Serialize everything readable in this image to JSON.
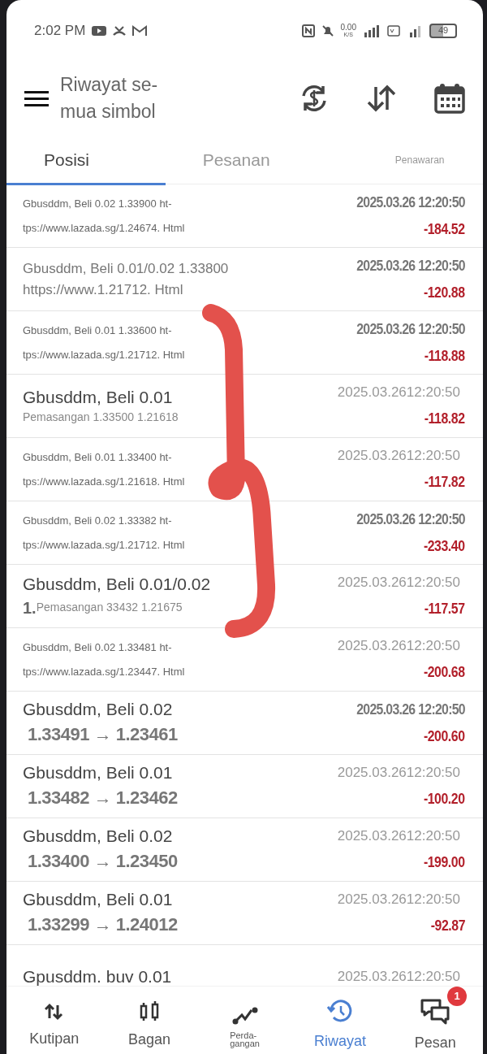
{
  "status_bar": {
    "time": "2:02 PM",
    "net_speed": "0.00",
    "net_unit": "K/S",
    "battery": "49"
  },
  "app_bar": {
    "title": "Riwayat se-\nmua simbol"
  },
  "tabs": [
    {
      "label": "Posisi",
      "selected": true
    },
    {
      "label": "Pesanan",
      "selected": false
    },
    {
      "label": "Penawaran",
      "selected": false,
      "kind": "small"
    }
  ],
  "rows": [
    {
      "kind": "small",
      "line1": "Gbusddm, Beli 0.02 1.33900 ht-",
      "line2": "tps://www.lazada.sg/1.24674. Html",
      "date": "2025.03.26 12:20:50",
      "date_bold": true,
      "profit": "-184.52"
    },
    {
      "kind": "medium",
      "line1": "Gbusddm, Beli 0.01/0.02 1.33800",
      "line2": "https://www.1.21712. Html",
      "date": "2025.03.26 12:20:50",
      "date_bold": true,
      "profit": "-120.88"
    },
    {
      "kind": "small",
      "line1": "Gbusddm, Beli 0.01 1.33600 ht-",
      "line2": "tps://www.lazada.sg/1.21712. Html",
      "date": "2025.03.26 12:20:50",
      "date_bold": true,
      "profit": "-118.88"
    },
    {
      "kind": "large",
      "line1": "Gbusddm, Beli 0.01",
      "line2": "Pemasangan 1.33500 1.21618",
      "date": "2025.03.2612:20:50",
      "date_bold": false,
      "profit": "-118.82"
    },
    {
      "kind": "small",
      "line1": "Gbusddm, Beli 0.01 1.33400 ht-",
      "line2": "tps://www.lazada.sg/1.21618. Html",
      "date": "2025.03.2612:20:50",
      "date_bold": false,
      "profit": "-117.82"
    },
    {
      "kind": "small",
      "line1": "Gbusddm, Beli 0.02 1.33382 ht-",
      "line2": "tps://www.lazada.sg/1.21712. Html",
      "date": "2025.03.26 12:20:50",
      "date_bold": true,
      "profit": "-233.40"
    },
    {
      "kind": "large",
      "line1": "Gbusddm, Beli 0.01/0.02",
      "prefix": "1.",
      "line2": "Pemasangan 33432 1.21675",
      "date": "2025.03.2612:20:50",
      "date_bold": false,
      "profit": "-117.57"
    },
    {
      "kind": "small",
      "line1": "Gbusddm, Beli 0.02 1.33481 ht-",
      "line2": "tps://www.lazada.sg/1.23447. Html",
      "date": "2025.03.2612:20:50",
      "date_bold": false,
      "profit": "-200.68"
    },
    {
      "kind": "prices",
      "line1": "Gbusddm, Beli 0.02",
      "line2": "1.33491 → 1.23461",
      "date": "2025.03.26 12:20:50",
      "date_bold": true,
      "profit": "-200.60"
    },
    {
      "kind": "prices",
      "line1": "Gbusddm, Beli 0.01",
      "line2": "1.33482 → 1.23462",
      "date": "2025.03.2612:20:50",
      "date_bold": false,
      "profit": "-100.20"
    },
    {
      "kind": "prices",
      "line1": "Gbusddm, Beli 0.02",
      "line2": "1.33400 → 1.23450",
      "date": "2025.03.2612:20:50",
      "date_bold": false,
      "profit": "-199.00"
    },
    {
      "kind": "prices",
      "line1": "Gbusddm, Beli 0.01",
      "line2": "1.33299 → 1.24012",
      "date": "2025.03.2612:20:50",
      "date_bold": false,
      "profit": "-92.87"
    },
    {
      "kind": "prices",
      "line1": "Gpusddm. buv 0.01",
      "date": "2025.03.2612:20:50",
      "date_bold": false
    }
  ],
  "bottom_nav": [
    {
      "label": "Kutipan",
      "selected": false
    },
    {
      "label": "Bagan",
      "selected": false
    },
    {
      "label": "Perda-\ngangan",
      "selected": false,
      "kind": "small"
    },
    {
      "label": "Riwayat",
      "selected": true
    },
    {
      "label": "Pesan",
      "selected": false,
      "badge": "1"
    }
  ],
  "annotation": {
    "kind": "brace"
  }
}
